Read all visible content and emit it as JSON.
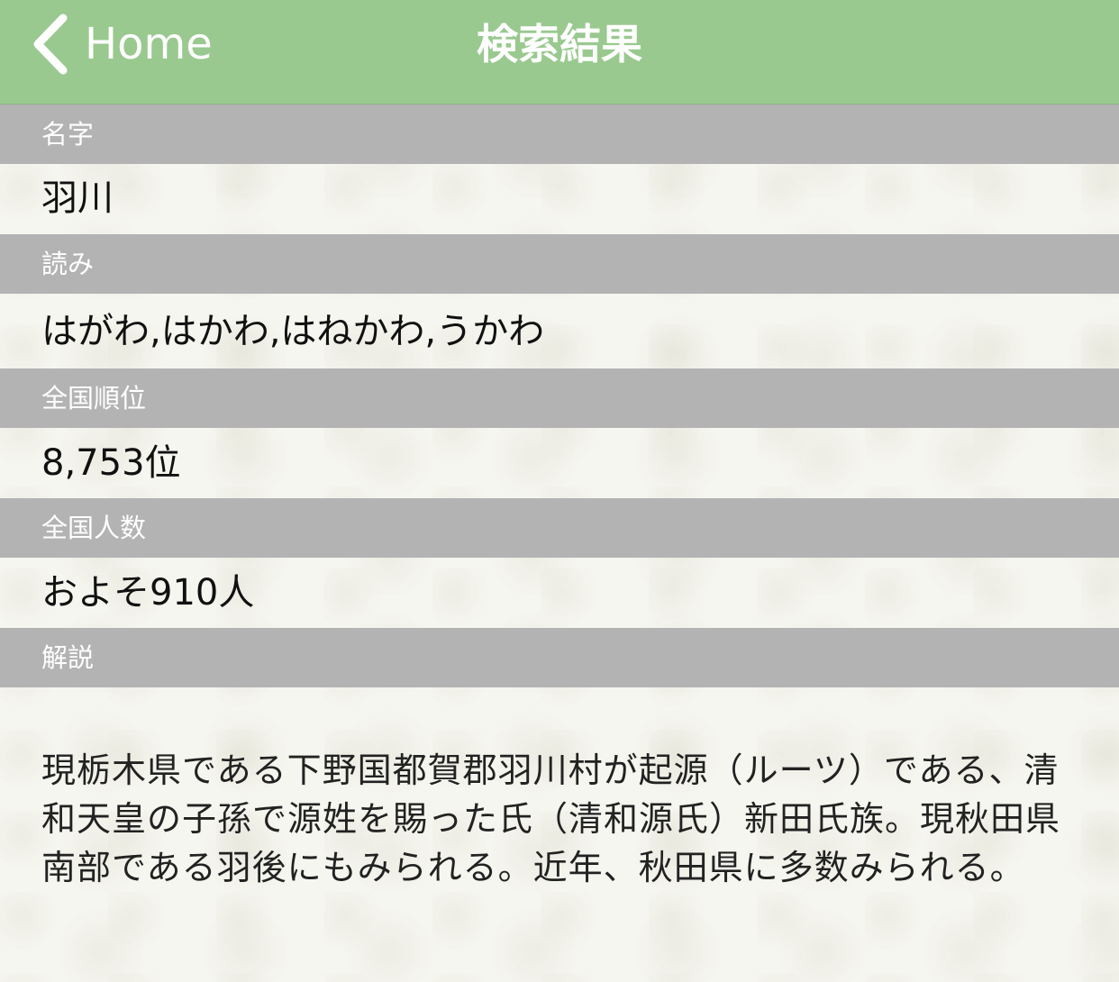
{
  "nav": {
    "back_label": "Home",
    "title": "検索結果",
    "bar_color": "#99c98f"
  },
  "sections": {
    "surname": {
      "header": "名字",
      "value": "羽川"
    },
    "reading": {
      "header": "読み",
      "value": "はがわ,はかわ,はねかわ,うかわ"
    },
    "rank": {
      "header": "全国順位",
      "value": "8,753位"
    },
    "population": {
      "header": "全国人数",
      "value": "およそ910人"
    },
    "description": {
      "header": "解説",
      "value": "現栃木県である下野国都賀郡羽川村が起源（ルーツ）である、清和天皇の子孫で源姓を賜った氏（清和源氏）新田氏族。現秋田県南部である羽後にもみられる。近年、秋田県に多数みられる。"
    }
  },
  "icons": {
    "back": "chevron-left-icon"
  },
  "colors": {
    "section_header": "#b3b3b3",
    "background": "#f6f6f0"
  }
}
